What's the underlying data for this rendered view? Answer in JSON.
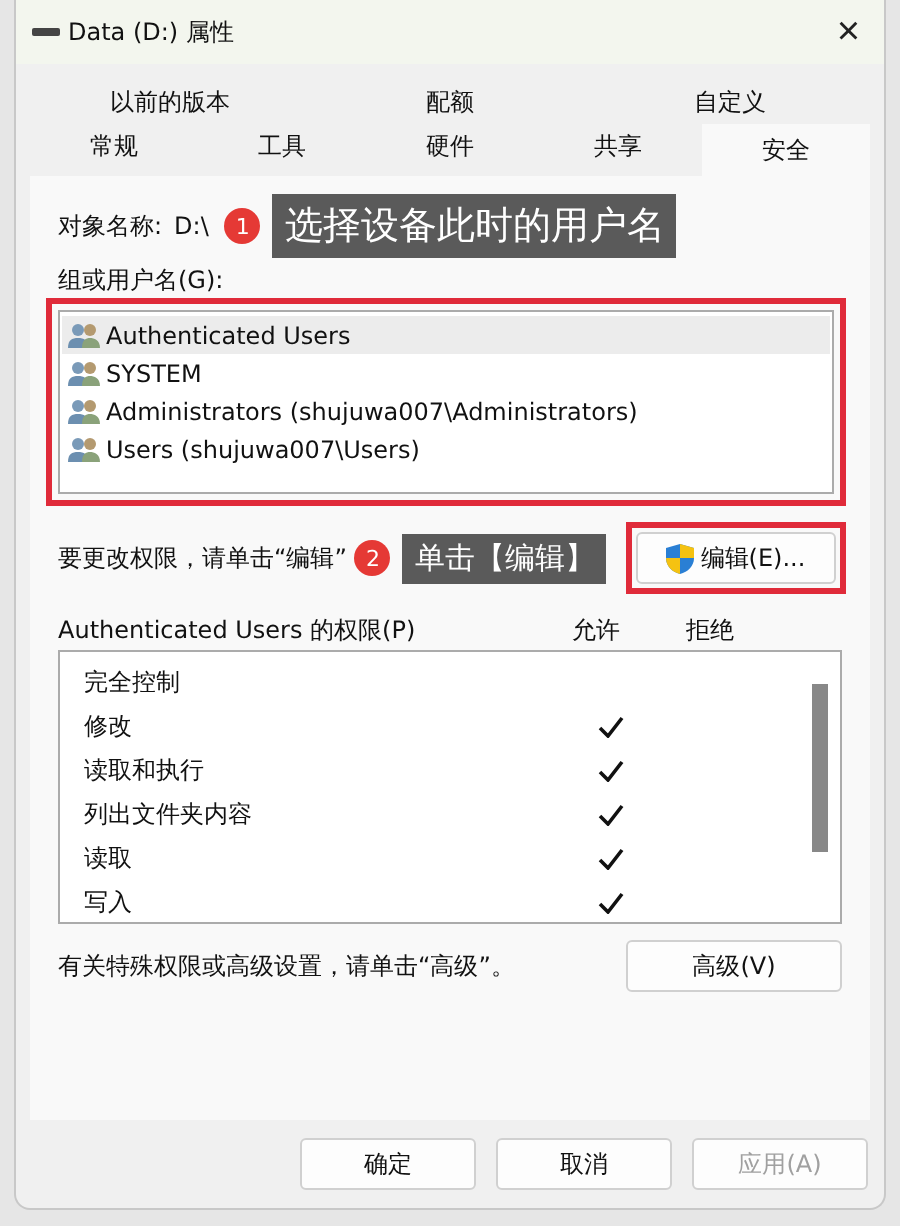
{
  "window": {
    "title": "Data (D:) 属性",
    "close": "×"
  },
  "tab_rows": [
    [
      {
        "label": "以前的版本",
        "selected": false
      },
      {
        "label": "配额",
        "selected": false
      },
      {
        "label": "自定义",
        "selected": false
      }
    ],
    [
      {
        "label": "常规",
        "selected": false
      },
      {
        "label": "工具",
        "selected": false
      },
      {
        "label": "硬件",
        "selected": false
      },
      {
        "label": "共享",
        "selected": false
      },
      {
        "label": "安全",
        "selected": true
      }
    ]
  ],
  "object": {
    "label": "对象名称:",
    "value": "D:\\"
  },
  "callouts": [
    {
      "number": "1",
      "text": "选择设备此时的用户名"
    },
    {
      "number": "2",
      "text": "单击【编辑】"
    }
  ],
  "group_label": "组或用户名(G):",
  "users": [
    {
      "name": "Authenticated Users",
      "selected": true
    },
    {
      "name": "SYSTEM",
      "selected": false
    },
    {
      "name": "Administrators (shujuwa007\\Administrators)",
      "selected": false
    },
    {
      "name": "Users (shujuwa007\\Users)",
      "selected": false
    }
  ],
  "edit_hint": "要更改权限，请单击“编辑”",
  "edit_button": "编辑(E)...",
  "permissions_header": {
    "title": "Authenticated Users 的权限(P)",
    "allow": "允许",
    "deny": "拒绝"
  },
  "permissions": [
    {
      "name": "完全控制",
      "allow": false,
      "deny": false
    },
    {
      "name": "修改",
      "allow": true,
      "deny": false
    },
    {
      "name": "读取和执行",
      "allow": true,
      "deny": false
    },
    {
      "name": "列出文件夹内容",
      "allow": true,
      "deny": false
    },
    {
      "name": "读取",
      "allow": true,
      "deny": false
    },
    {
      "name": "写入",
      "allow": true,
      "deny": false
    }
  ],
  "advanced_hint": "有关特殊权限或高级设置，请单击“高级”。",
  "advanced_button": "高级(V)",
  "footer_buttons": [
    {
      "label": "确定",
      "disabled": false
    },
    {
      "label": "取消",
      "disabled": false
    },
    {
      "label": "应用(A)",
      "disabled": true
    }
  ]
}
